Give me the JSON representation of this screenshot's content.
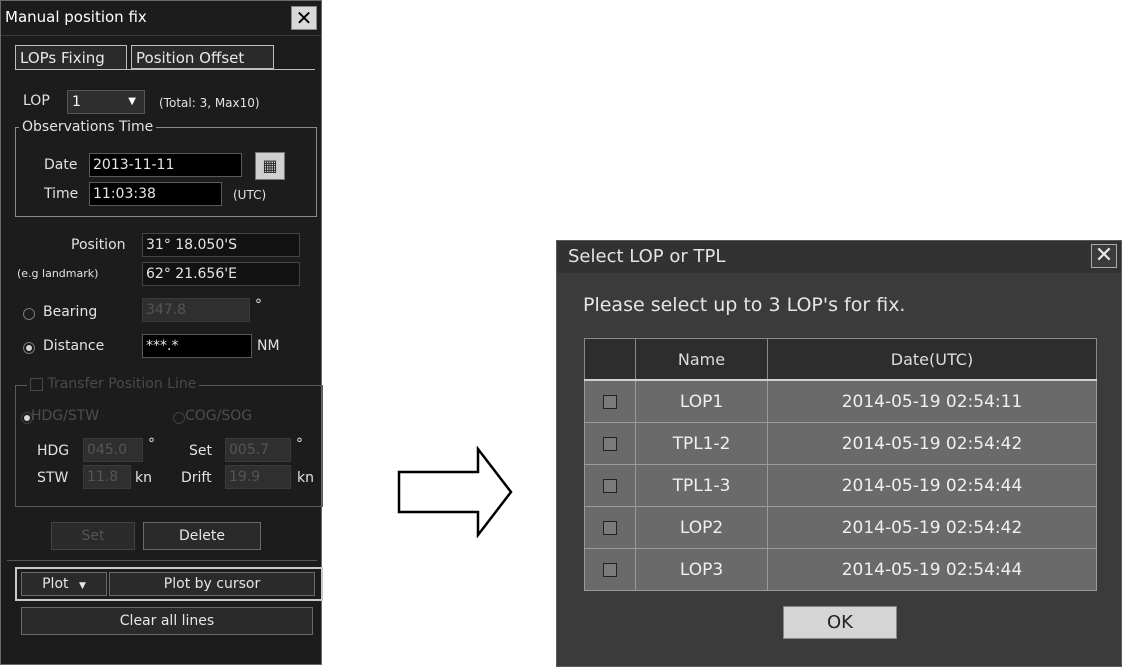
{
  "left_panel": {
    "title": "Manual position fix",
    "tabs": [
      "LOPs Fixing",
      "Position Offset"
    ],
    "lop_label": "LOP",
    "lop_value": "1",
    "lop_total": "(Total: 3, Max10)",
    "obs_group": "Observations Time",
    "date_label": "Date",
    "date_value": "2013-11-11",
    "time_label": "Time",
    "time_value": "11:03:38",
    "utc": "(UTC)",
    "position_label": "Position",
    "landmark_label": "(e.g landmark)",
    "lat": "31° 18.050'S",
    "lon": "62° 21.656'E",
    "bearing_label": "Bearing",
    "bearing_value": "347.8",
    "deg_symbol": "°",
    "distance_label": "Distance",
    "distance_value": "***.*",
    "nm": "NM",
    "transfer_group": "Transfer Position Line",
    "hdg_stw": "HDG/STW",
    "cog_sog": "COG/SOG",
    "hdg_label": "HDG",
    "hdg_value": "045.0",
    "set_label": "Set",
    "set_value": "005.7",
    "stw_label": "STW",
    "stw_value": "11.8",
    "kn": "kn",
    "drift_label": "Drift",
    "drift_value": "19.9",
    "set_button": "Set",
    "delete_button": "Delete",
    "plot_button": "Plot",
    "plot_cursor_button": "Plot by cursor",
    "clear_button": "Clear all lines"
  },
  "dialog": {
    "title": "Select LOP or TPL",
    "message": "Please select up to 3 LOP's for fix.",
    "columns": [
      "Name",
      "Date(UTC)"
    ],
    "rows": [
      {
        "name": "LOP1",
        "date": "2014-05-19 02:54:11",
        "checked": false
      },
      {
        "name": "TPL1-2",
        "date": "2014-05-19 02:54:42",
        "checked": false
      },
      {
        "name": "TPL1-3",
        "date": "2014-05-19 02:54:44",
        "checked": false
      },
      {
        "name": "LOP2",
        "date": "2014-05-19 02:54:42",
        "checked": false
      },
      {
        "name": "LOP3",
        "date": "2014-05-19 02:54:44",
        "checked": false
      }
    ],
    "ok": "OK"
  }
}
